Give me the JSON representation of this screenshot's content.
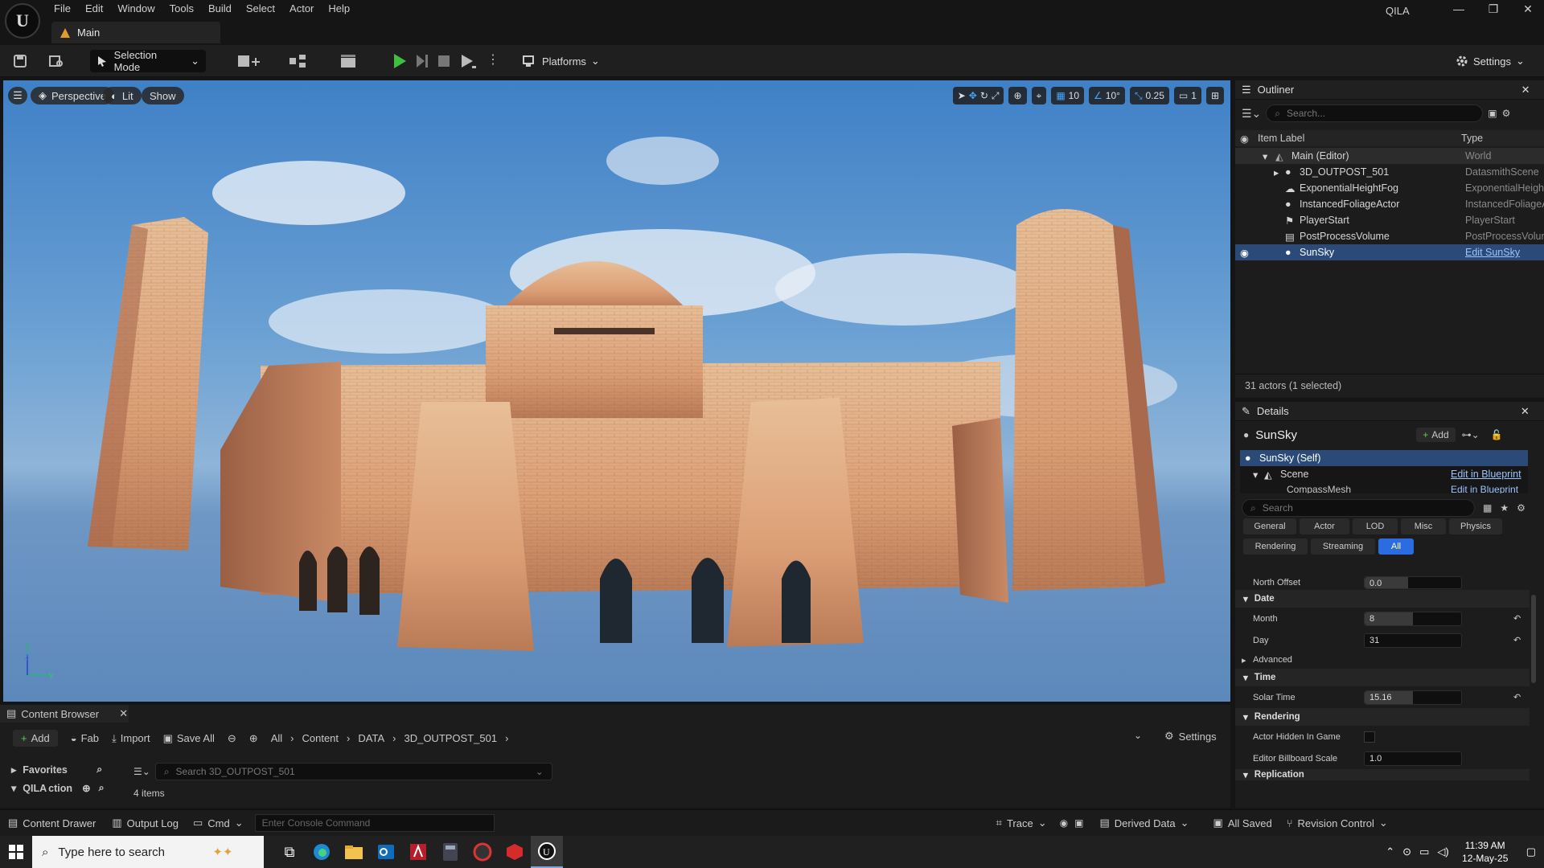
{
  "window": {
    "app_initials": "U",
    "user": "QILA",
    "menu": [
      "File",
      "Edit",
      "Window",
      "Tools",
      "Build",
      "Select",
      "Actor",
      "Help"
    ],
    "doc_tab": "Main",
    "minimize": "—",
    "restore": "❐",
    "close": "✕"
  },
  "toolbar": {
    "selection_mode": "Selection Mode",
    "platforms": "Platforms",
    "settings": "Settings"
  },
  "viewport": {
    "perspective": "Perspective",
    "lit": "Lit",
    "show": "Show",
    "grid_size": "10",
    "rotation_snap": "10°",
    "scale_snap": "0.25",
    "camera_speed": "1",
    "axis_z": "Z",
    "axis_y": "Y"
  },
  "outliner": {
    "title": "Outliner",
    "search_placeholder": "Search...",
    "col_label": "Item Label",
    "col_type": "Type",
    "rows": [
      {
        "label": "Main (Editor)",
        "type": "World"
      },
      {
        "label": "3D_OUTPOST_501",
        "type": "DatasmithScene"
      },
      {
        "label": "ExponentialHeightFog",
        "type": "ExponentialHeightFog"
      },
      {
        "label": "InstancedFoliageActor",
        "type": "InstancedFoliageActor"
      },
      {
        "label": "PlayerStart",
        "type": "PlayerStart"
      },
      {
        "label": "PostProcessVolume",
        "type": "PostProcessVolume"
      },
      {
        "label": "SunSky",
        "type": "Edit SunSky"
      }
    ],
    "footer": "31 actors (1 selected)"
  },
  "details": {
    "title": "Details",
    "actor": "SunSky",
    "add": "Add",
    "self": "SunSky (Self)",
    "scene": "Scene",
    "compass": "CompassMesh",
    "edit_bp": "Edit in Blueprint",
    "search_placeholder": "Search",
    "tabs1": [
      "General",
      "Actor",
      "LOD",
      "Misc",
      "Physics"
    ],
    "tabs2": [
      "Rendering",
      "Streaming",
      "All"
    ],
    "north_offset_label": "North Offset",
    "north_offset": "0.0",
    "cat_date": "Date",
    "month_label": "Month",
    "month": "8",
    "day_label": "Day",
    "day": "31",
    "cat_advanced": "Advanced",
    "cat_time": "Time",
    "solar_time_label": "Solar Time",
    "solar_time": "15.16",
    "cat_rendering": "Rendering",
    "hidden_label": "Actor Hidden In Game",
    "billboard_label": "Editor Billboard Scale",
    "billboard": "1.0",
    "cat_replication": "Replication"
  },
  "content_browser": {
    "title": "Content Browser",
    "add": "Add",
    "fab": "Fab",
    "import": "Import",
    "save_all": "Save All",
    "path": [
      "All",
      "Content",
      "DATA",
      "3D_OUTPOST_501"
    ],
    "settings": "Settings",
    "favorites": "Favorites",
    "collection": "QILA",
    "collection_suffix": "ction",
    "search_placeholder": "Search 3D_OUTPOST_501",
    "items": "4 items"
  },
  "statusbar": {
    "content_drawer": "Content Drawer",
    "output_log": "Output Log",
    "cmd": "Cmd",
    "console_placeholder": "Enter Console Command",
    "trace": "Trace",
    "derived_data": "Derived Data",
    "all_saved": "All Saved",
    "revision_control": "Revision Control"
  },
  "taskbar": {
    "search_placeholder": "Type here to search",
    "time": "11:39 AM",
    "date": "12-May-25"
  }
}
